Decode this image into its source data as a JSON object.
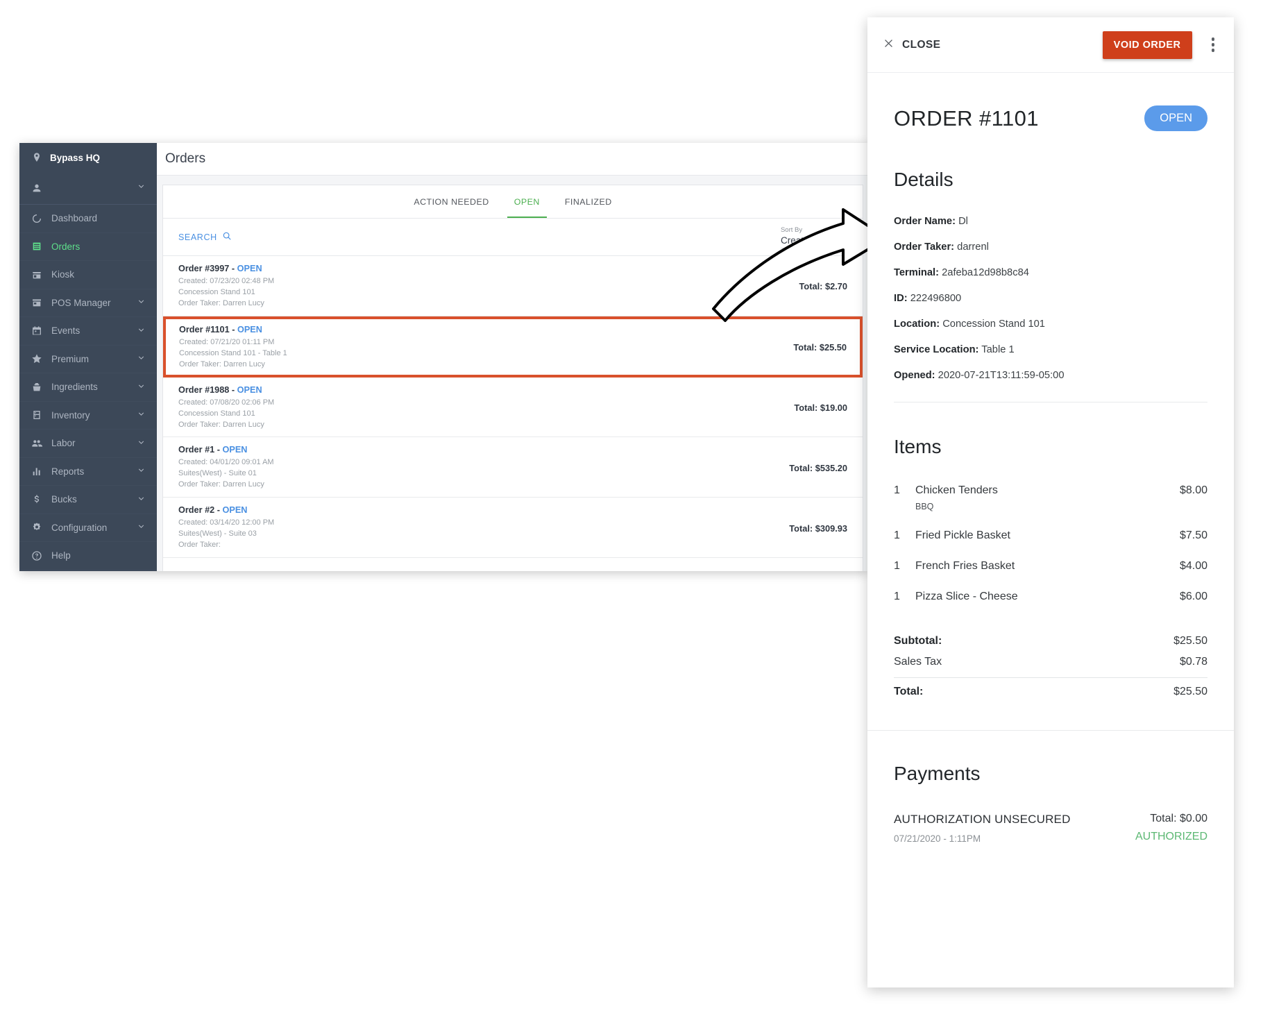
{
  "left_window": {
    "sidebar": {
      "brand": "Bypass HQ",
      "items": [
        {
          "label": "Dashboard",
          "icon": "dashboard-icon",
          "expandable": false
        },
        {
          "label": "Orders",
          "icon": "orders-icon",
          "expandable": false,
          "active": true
        },
        {
          "label": "Kiosk",
          "icon": "kiosk-icon",
          "expandable": false
        },
        {
          "label": "POS Manager",
          "icon": "pos-manager-icon",
          "expandable": true
        },
        {
          "label": "Events",
          "icon": "calendar-icon",
          "expandable": true
        },
        {
          "label": "Premium",
          "icon": "star-icon",
          "expandable": true
        },
        {
          "label": "Ingredients",
          "icon": "basket-icon",
          "expandable": true
        },
        {
          "label": "Inventory",
          "icon": "inventory-icon",
          "expandable": true
        },
        {
          "label": "Labor",
          "icon": "people-icon",
          "expandable": true
        },
        {
          "label": "Reports",
          "icon": "bar-chart-icon",
          "expandable": true
        },
        {
          "label": "Bucks",
          "icon": "dollar-icon",
          "expandable": true
        },
        {
          "label": "Configuration",
          "icon": "gear-icon",
          "expandable": true
        },
        {
          "label": "Help",
          "icon": "help-circle-icon",
          "expandable": false
        }
      ]
    },
    "topbar": {
      "title": "Orders"
    },
    "tabs": [
      {
        "label": "ACTION NEEDED",
        "active": false
      },
      {
        "label": "OPEN",
        "active": true
      },
      {
        "label": "FINALIZED",
        "active": false
      }
    ],
    "toolbar": {
      "search_label": "SEARCH",
      "sort_by_label": "Sort By",
      "sort_by_value": "Created",
      "sort_direction": "descending"
    },
    "orders": [
      {
        "number": "Order #3997",
        "separator": "-",
        "status": "OPEN",
        "created": "Created: 07/23/20 02:48 PM",
        "location": "Concession Stand 101",
        "taker": "Order Taker: Darren Lucy",
        "total": "Total: $2.70",
        "highlighted": false
      },
      {
        "number": "Order #1101",
        "separator": "-",
        "status": "OPEN",
        "created": "Created: 07/21/20 01:11 PM",
        "location": "Concession Stand 101 - Table 1",
        "taker": "Order Taker: Darren Lucy",
        "total": "Total: $25.50",
        "highlighted": true
      },
      {
        "number": "Order #1988",
        "separator": "-",
        "status": "OPEN",
        "created": "Created: 07/08/20 02:06 PM",
        "location": "Concession Stand 101",
        "taker": "Order Taker: Darren Lucy",
        "total": "Total: $19.00",
        "highlighted": false
      },
      {
        "number": "Order #1",
        "separator": "-",
        "status": "OPEN",
        "created": "Created: 04/01/20 09:01 AM",
        "location": "Suites(West) - Suite 01",
        "taker": "Order Taker: Darren Lucy",
        "total": "Total: $535.20",
        "highlighted": false
      },
      {
        "number": "Order #2",
        "separator": "-",
        "status": "OPEN",
        "created": "Created: 03/14/20 12:00 PM",
        "location": "Suites(West) - Suite 03",
        "taker": "Order Taker:",
        "total": "Total: $309.93",
        "highlighted": false
      }
    ]
  },
  "detail_panel": {
    "header": {
      "close_label": "CLOSE",
      "void_label": "VOID ORDER",
      "overflow_icon": "kebab-menu-icon"
    },
    "order_title": "ORDER #1101",
    "status_badge": "OPEN",
    "details": {
      "heading": "Details",
      "rows": [
        {
          "label": "Order Name:",
          "value": "Dl"
        },
        {
          "label": "Order Taker:",
          "value": "darrenl"
        },
        {
          "label": "Terminal:",
          "value": "2afeba12d98b8c84"
        },
        {
          "label": "ID:",
          "value": "222496800"
        },
        {
          "label": "Location:",
          "value": "Concession Stand 101"
        },
        {
          "label": "Service Location:",
          "value": "Table 1"
        },
        {
          "label": "Opened:",
          "value": "2020-07-21T13:11:59-05:00"
        }
      ]
    },
    "items": {
      "heading": "Items",
      "list": [
        {
          "qty": "1",
          "name": "Chicken Tenders",
          "price": "$8.00",
          "modifier": "BBQ"
        },
        {
          "qty": "1",
          "name": "Fried Pickle Basket",
          "price": "$7.50",
          "modifier": ""
        },
        {
          "qty": "1",
          "name": "French Fries Basket",
          "price": "$4.00",
          "modifier": ""
        },
        {
          "qty": "1",
          "name": "Pizza Slice - Cheese",
          "price": "$6.00",
          "modifier": ""
        }
      ],
      "totals": [
        {
          "label": "Subtotal:",
          "value": "$25.50",
          "bold": true
        },
        {
          "label": "Sales Tax",
          "value": "$0.78",
          "bold": false
        },
        {
          "label": "Total:",
          "value": "$25.50",
          "bold": true
        }
      ]
    },
    "payments": {
      "heading": "Payments",
      "rows": [
        {
          "name": "AUTHORIZATION UNSECURED",
          "date": "07/21/2020 - 1:11PM",
          "total": "Total: $0.00",
          "status": "AUTHORIZED"
        }
      ]
    }
  },
  "colors": {
    "sidebar_bg": "#3c4858",
    "active_green": "#4caf50",
    "link_blue": "#4a90e2",
    "void_red": "#cf3f1b",
    "highlight_border": "#d9512c",
    "status_blue": "#5b9bea",
    "authorized_green": "#5cb873"
  }
}
